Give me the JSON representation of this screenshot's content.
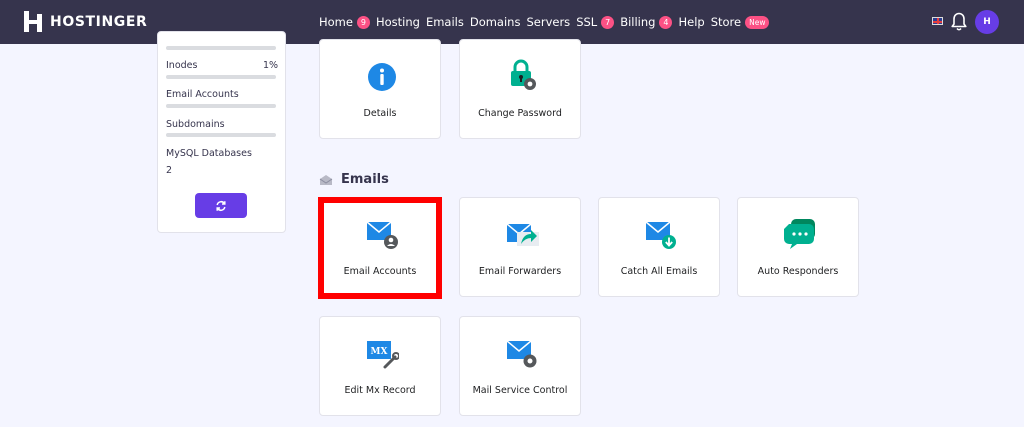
{
  "brand": {
    "name": "HOSTINGER",
    "avatar_initial": "H"
  },
  "nav": [
    {
      "label": "Home",
      "badge": "9"
    },
    {
      "label": "Hosting",
      "badge": ""
    },
    {
      "label": "Emails",
      "badge": ""
    },
    {
      "label": "Domains",
      "badge": ""
    },
    {
      "label": "Servers",
      "badge": ""
    },
    {
      "label": "SSL",
      "badge": "7"
    },
    {
      "label": "Billing",
      "badge": "4"
    },
    {
      "label": "Help",
      "badge": ""
    },
    {
      "label": "Store",
      "badge": "New"
    }
  ],
  "sidebar": {
    "inodes_label": "Inodes",
    "inodes_value": "1%",
    "email_accounts_label": "Email Accounts",
    "subdomains_label": "Subdomains",
    "mysql_label": "MySQL Databases",
    "mysql_value": "2"
  },
  "tiles_top": [
    {
      "label": "Details"
    },
    {
      "label": "Change Password"
    }
  ],
  "emails_section": {
    "title": "Emails",
    "tiles": [
      {
        "label": "Email Accounts"
      },
      {
        "label": "Email Forwarders"
      },
      {
        "label": "Catch All Emails"
      },
      {
        "label": "Auto Responders"
      },
      {
        "label": "Edit Mx Record"
      },
      {
        "label": "Mail Service Control"
      }
    ]
  },
  "colors": {
    "nav_bg": "#36344d",
    "accent": "#673de6",
    "badge": "#fc5185",
    "highlight": "#ff0000",
    "icon_blue": "#1e88e5",
    "icon_green": "#00b090"
  }
}
